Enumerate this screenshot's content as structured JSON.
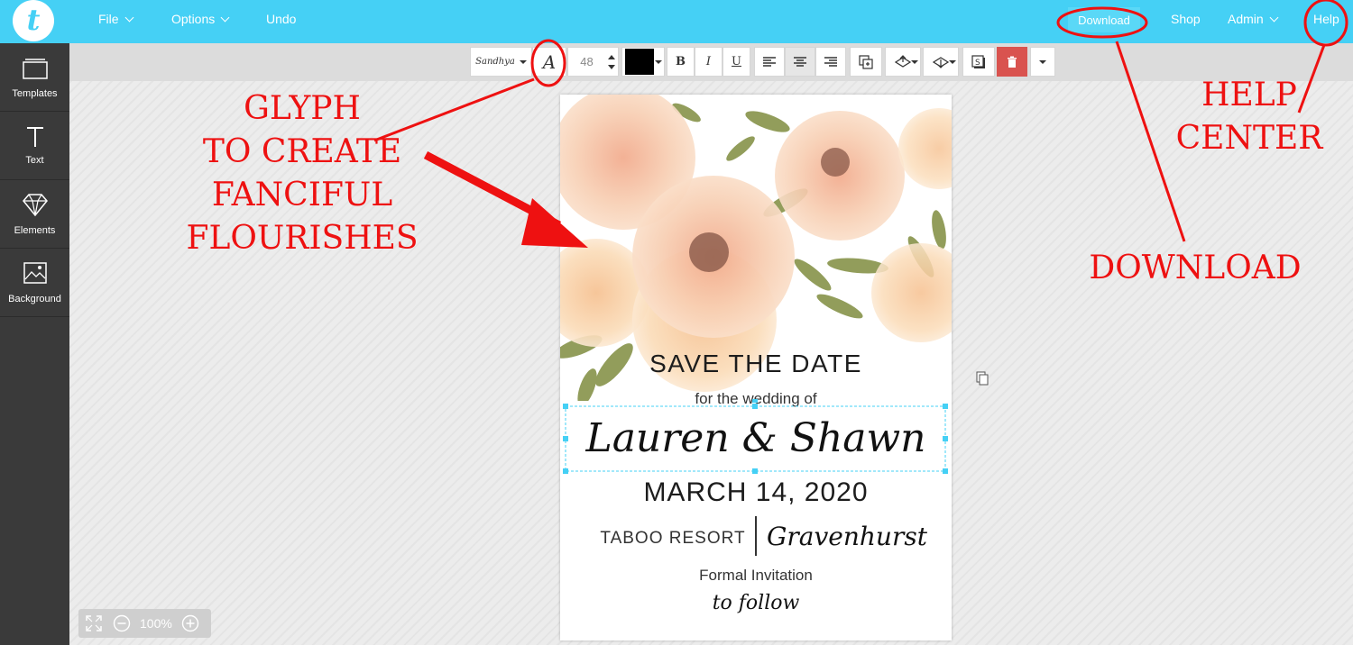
{
  "topbar": {
    "logo_letter": "t",
    "menu": {
      "file": "File",
      "options": "Options",
      "undo": "Undo"
    },
    "download": "Download",
    "shop": "Shop",
    "admin": "Admin",
    "help": "Help"
  },
  "sidebar": {
    "items": [
      {
        "label": "Templates",
        "icon": "templates-icon"
      },
      {
        "label": "Text",
        "icon": "text-icon"
      },
      {
        "label": "Elements",
        "icon": "diamond-icon"
      },
      {
        "label": "Background",
        "icon": "image-icon"
      }
    ]
  },
  "toolbar": {
    "font_name": "Sandhya",
    "glyph_symbol": "A",
    "font_size": "48",
    "color": "#000000",
    "bold": "B",
    "italic": "I",
    "underline": "U"
  },
  "card": {
    "headline": "SAVE THE DATE",
    "subline": "for the wedding of",
    "names": "Lauren & Shawn",
    "date": "MARCH 14, 2020",
    "venue": "TABOO RESORT",
    "city": "Gravenhurst",
    "formal": "Formal Invitation",
    "follow": "to follow"
  },
  "annotations": {
    "glyph_lines": [
      "GLYPH",
      "TO CREATE",
      "FANCIFUL",
      "FLOURISHES"
    ],
    "help_lines": [
      "HELP",
      "CENTER"
    ],
    "download": "DOWNLOAD",
    "color": "#ee1111"
  },
  "zoom": {
    "level": "100%"
  },
  "colors": {
    "topbar": "#45d0f5",
    "sidebar": "#3a3a3a",
    "delete": "#d9534f",
    "selection": "#45d0f5"
  }
}
